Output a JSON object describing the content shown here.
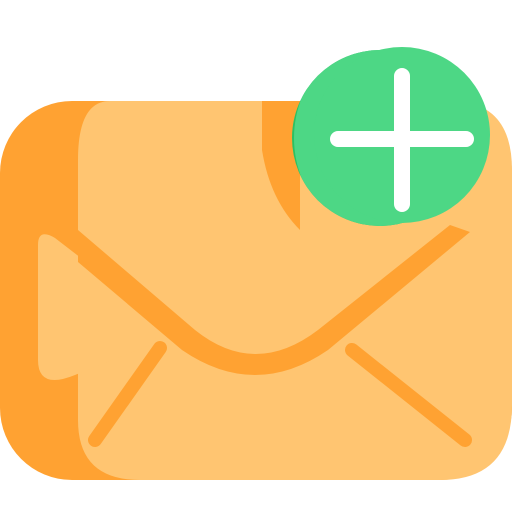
{
  "icon": {
    "name": "add-mail-icon",
    "parts": {
      "envelope": "envelope-icon",
      "badge": "plus-badge-icon"
    }
  },
  "colors": {
    "envelope_back": "#FFA232",
    "envelope_front": "#FFC571",
    "envelope_fold": "#FFA232",
    "badge_shadow": "#2BC163",
    "badge_main": "#4DD785",
    "plus": "#FFFFFF"
  }
}
